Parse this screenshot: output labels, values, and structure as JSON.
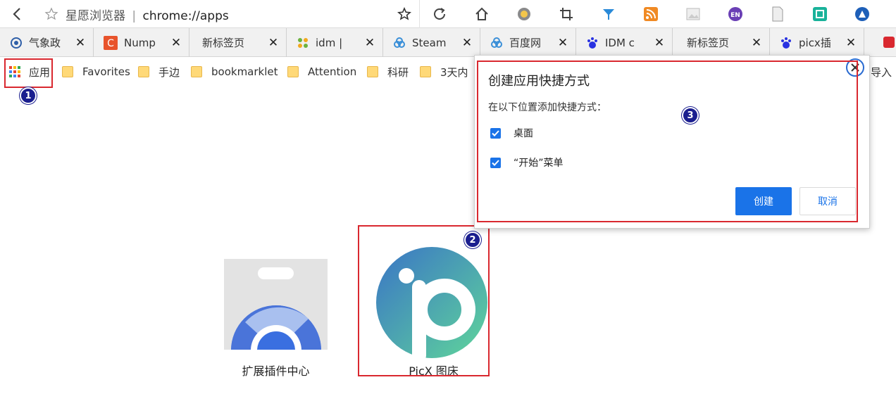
{
  "toolbar": {
    "browser_name": "星愿浏览器",
    "separator": "|",
    "url": "chrome://apps",
    "icons": [
      "back-icon",
      "page-star-icon",
      "bookmark-star-icon",
      "reload-icon",
      "home-icon",
      "extension-chrome-icon",
      "crop-icon",
      "vpn-icon",
      "rss-icon",
      "image-icon",
      "en-icon",
      "document-icon",
      "screen-capture-icon",
      "account-icon"
    ]
  },
  "tabs": [
    {
      "title": "气象政",
      "icon": "weather-icon",
      "color": "#2f5fa8"
    },
    {
      "title": "Nump",
      "icon": "c-logo-icon",
      "color": "#e8532b"
    },
    {
      "title": "新标签页",
      "icon": "",
      "color": ""
    },
    {
      "title": "idm |",
      "icon": "idm-icon",
      "color": "#6cb33f"
    },
    {
      "title": "Steam",
      "icon": "cloud-icon",
      "color": "#3a8fd8"
    },
    {
      "title": "百度网",
      "icon": "cloud-icon",
      "color": "#3a8fd8"
    },
    {
      "title": "IDM c",
      "icon": "baidu-paw-icon",
      "color": "#2932e1"
    },
    {
      "title": "新标签页",
      "icon": "",
      "color": ""
    },
    {
      "title": "picx插",
      "icon": "baidu-paw-icon",
      "color": "#2932e1"
    }
  ],
  "tab_close": "✕",
  "bookmarks": {
    "apps_label": "应用",
    "items": [
      "Favorites",
      "手边",
      "bookmarklet",
      "Attention",
      "科研",
      "3天内"
    ],
    "overflow": "导入"
  },
  "dialog": {
    "title": "创建应用快捷方式",
    "subtitle": "在以下位置添加快捷方式：",
    "options": [
      {
        "label": "桌面",
        "checked": true
      },
      {
        "label": "“开始”菜单",
        "checked": true
      }
    ],
    "create": "创建",
    "cancel": "取消"
  },
  "apps": [
    {
      "label": "扩展插件中心"
    },
    {
      "label": "PicX 图床"
    }
  ],
  "badges": [
    "1",
    "2",
    "3"
  ],
  "colors": {
    "accent": "#1a73e8",
    "annotation_red": "#d9282f",
    "badge_blue": "#1a1e8f"
  }
}
